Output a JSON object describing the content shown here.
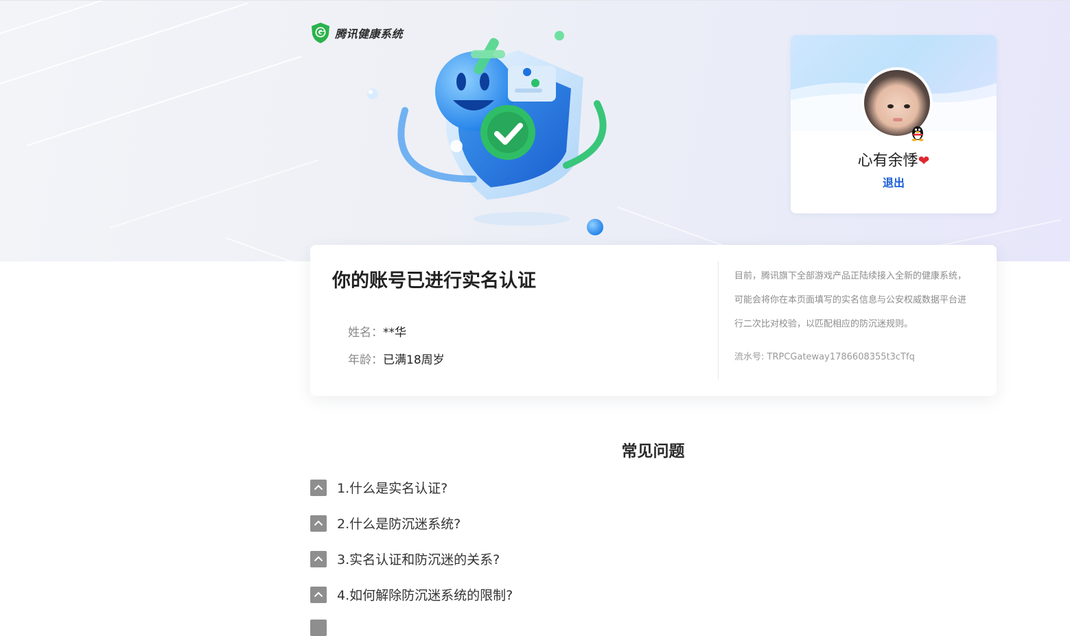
{
  "brand": {
    "name": "腾讯健康系统",
    "icon": "shield-g-icon",
    "color": "#2bb24c"
  },
  "user": {
    "name": "心有余悸",
    "emoji": "❤",
    "logout_label": "退出"
  },
  "main": {
    "title": "你的账号已进行实名认证",
    "fields": [
      {
        "label": "姓名：",
        "value": "**华"
      },
      {
        "label": "年龄：",
        "value": "已满18周岁"
      }
    ],
    "notice": "目前，腾讯旗下全部游戏产品正陆续接入全新的健康系统，可能会将你在本页面填写的实名信息与公安权威数据平台进行二次比对校验，以匹配相应的防沉迷规则。",
    "serial_label": "流水号: ",
    "serial_value": "TRPCGateway1786608355t3cTfq"
  },
  "faq": {
    "title": "常见问题",
    "items": [
      {
        "label": "1.什么是实名认证?"
      },
      {
        "label": "2.什么是防沉迷系统?"
      },
      {
        "label": "3.实名认证和防沉迷的关系?"
      },
      {
        "label": "4.如何解除防沉迷系统的限制?"
      },
      {
        "label": ""
      }
    ]
  },
  "colors": {
    "accent": "#1a5fd6",
    "text": "#222222",
    "muted": "#8a8a8a"
  }
}
